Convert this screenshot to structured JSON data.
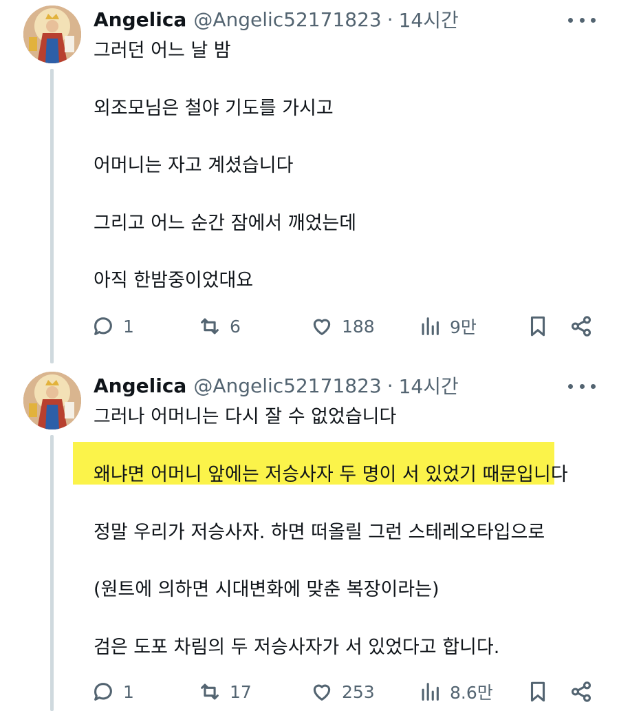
{
  "posts": [
    {
      "author": {
        "name": "Angelica",
        "handle": "@Angelic52171823",
        "separator": "·",
        "time": "14시간"
      },
      "paragraphs": [
        "그러던 어느 날 밤",
        "외조모님은 철야 기도를 가시고",
        "어머니는 자고 계셨습니다",
        "그리고 어느 순간 잠에서 깨었는데",
        "아직 한밤중이었대요"
      ],
      "stats": {
        "replies": "1",
        "reposts": "6",
        "likes": "188",
        "views": "9만"
      }
    },
    {
      "author": {
        "name": "Angelica",
        "handle": "@Angelic52171823",
        "separator": "·",
        "time": "14시간"
      },
      "paragraphs": [
        "그러나 어머니는 다시 잘 수 없었습니다",
        "왜냐면 어머니 앞에는 저승사자 두 명이 서 있었기 때문입니다",
        "정말 우리가 저승사자. 하면 떠올릴 그런 스테레오타입으로",
        "(원트에 의하면 시대변화에 맞춘 복장이라는)",
        "검은 도포 차림의 두 저승사자가 서 있었다고 합니다."
      ],
      "stats": {
        "replies": "1",
        "reposts": "17",
        "likes": "253",
        "views": "8.6만"
      }
    }
  ],
  "icons": {
    "reply": "speech-bubble-icon",
    "repost": "repost-arrows-icon",
    "like": "heart-icon",
    "views": "bar-chart-icon",
    "bookmark": "bookmark-icon",
    "share": "share-icon",
    "more": "more-dots-icon"
  },
  "colors": {
    "text": "#0f1419",
    "secondary": "#536471",
    "highlight": "#fbf34a",
    "thread_line": "#cfd9de"
  }
}
